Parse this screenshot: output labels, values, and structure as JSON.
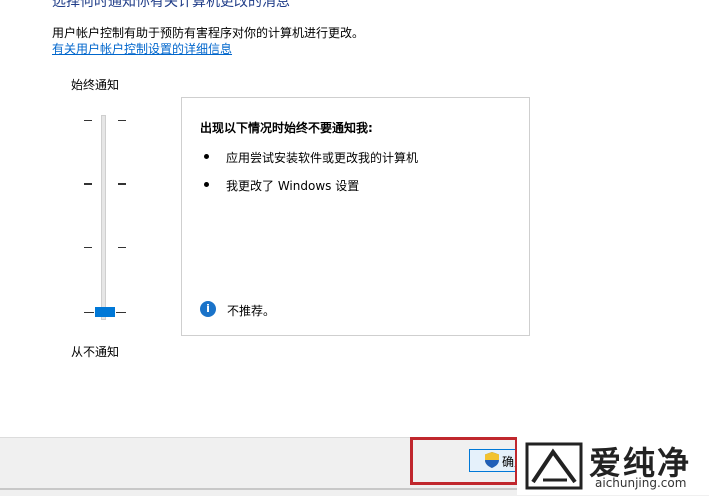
{
  "dialog": {
    "heading_partial": "选择何时通知你有关计算机更改的消息",
    "description": "用户帐户控制有助于预防有害程序对你的计算机进行更改。",
    "details_link": "有关用户帐户控制设置的详细信息"
  },
  "slider": {
    "top_label": "始终通知",
    "bottom_label": "从不通知",
    "level_count": 4,
    "selected_level": 1
  },
  "panel": {
    "title": "出现以下情况时始终不要通知我:",
    "items": [
      "应用尝试安装软件或更改我的计算机",
      "我更改了 Windows 设置"
    ],
    "info_text": "不推荐。",
    "info_icon": "info-icon"
  },
  "footer": {
    "ok_label": "确定",
    "ok_icon": "uac-shield-icon"
  },
  "watermark": {
    "brand": "爱纯净",
    "url": "aichunjing.com"
  },
  "colors": {
    "accent": "#0078d7",
    "link": "#0066cc",
    "highlight": "#c0272d"
  }
}
